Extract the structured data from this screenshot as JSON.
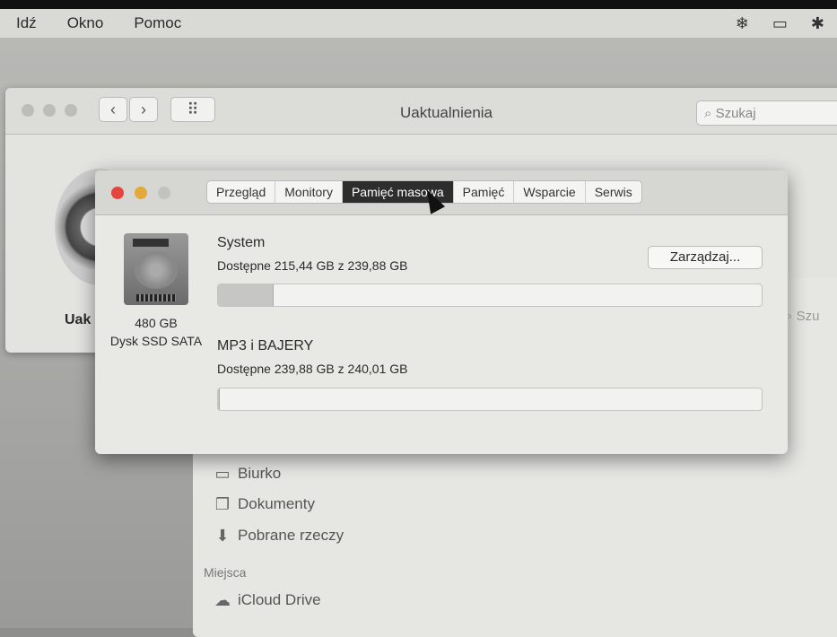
{
  "menubar": {
    "items": [
      "Idź",
      "Okno",
      "Pomoc"
    ],
    "status_icons": [
      "❄",
      "▭",
      "✱"
    ]
  },
  "updates_window": {
    "title": "Uaktualnienia",
    "search_placeholder": "Szukaj",
    "side_label": "Uak",
    "grid_icon": "⠿"
  },
  "finder": {
    "sidebar": [
      {
        "label": "Biurko",
        "icon": "▭"
      },
      {
        "label": "Dokumenty",
        "icon": "❐"
      },
      {
        "label": "Pobrane rzeczy",
        "icon": "⬇"
      }
    ],
    "section": "Miejsca",
    "places": [
      {
        "label": "iCloud Drive",
        "icon": "☁"
      }
    ],
    "search_placeholder": "Szu"
  },
  "system_info": {
    "tabs": [
      "Przegląd",
      "Monitory",
      "Pamięć masowa",
      "Pamięć",
      "Wsparcie",
      "Serwis"
    ],
    "active_tab": "Pamięć masowa",
    "disk": {
      "size": "480 GB",
      "type": "Dysk SSD SATA"
    },
    "manage_label": "Zarządzaj...",
    "volumes": [
      {
        "name": "System",
        "info": "Dostępne 215,44 GB z 239,88 GB",
        "used_percent": 10.2
      },
      {
        "name": "MP3 i BAJERY",
        "info": "Dostępne 239,88 GB z 240,01 GB",
        "used_percent": 0.1
      }
    ]
  }
}
